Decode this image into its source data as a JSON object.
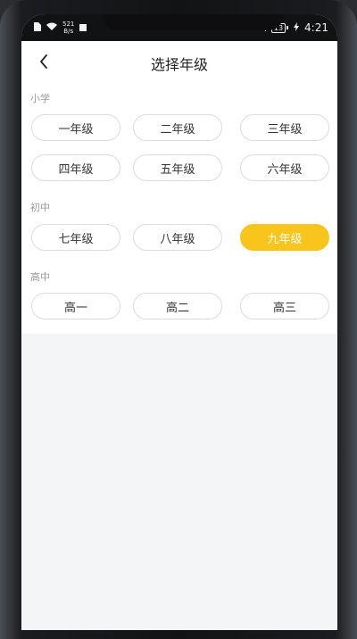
{
  "status_bar": {
    "speed_top": "521",
    "speed_bottom": "B/s",
    "battery": "13",
    "time": "4:21"
  },
  "header": {
    "title": "选择年级"
  },
  "sections": [
    {
      "label": "小学",
      "grades": [
        "一年级",
        "二年级",
        "三年级",
        "四年级",
        "五年级",
        "六年级"
      ]
    },
    {
      "label": "初中",
      "grades": [
        "七年级",
        "八年级",
        "九年级"
      ]
    },
    {
      "label": "高中",
      "grades": [
        "高一",
        "高二",
        "高三"
      ]
    }
  ],
  "selected_grade": "九年级",
  "colors": {
    "accent": "#f8c51c",
    "button_border": "#dcdcdc",
    "section_label": "#9a9a9a"
  }
}
